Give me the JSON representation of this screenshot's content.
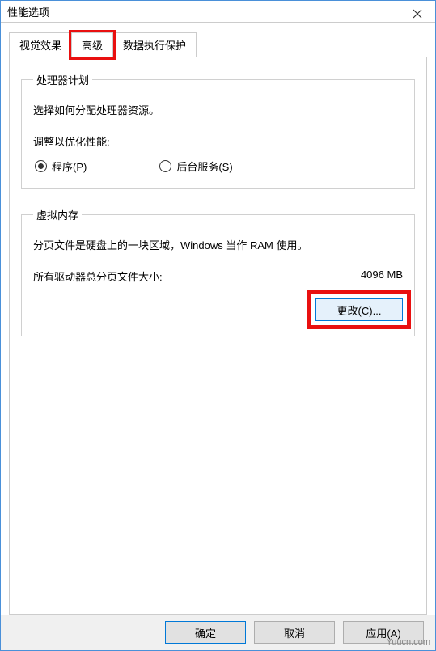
{
  "window": {
    "title": "性能选项"
  },
  "tabs": {
    "visual": "视觉效果",
    "advanced": "高级",
    "dep": "数据执行保护"
  },
  "processor": {
    "legend": "处理器计划",
    "desc": "选择如何分配处理器资源。",
    "adjust_label": "调整以优化性能:",
    "programs": "程序(P)",
    "services": "后台服务(S)"
  },
  "virtual_memory": {
    "legend": "虚拟内存",
    "desc": "分页文件是硬盘上的一块区域，Windows 当作 RAM 使用。",
    "total_label": "所有驱动器总分页文件大小:",
    "total_value": "4096 MB",
    "change_label": "更改(C)..."
  },
  "footer": {
    "ok": "确定",
    "cancel": "取消",
    "apply": "应用(A)"
  },
  "watermark": "Yuucn.com"
}
